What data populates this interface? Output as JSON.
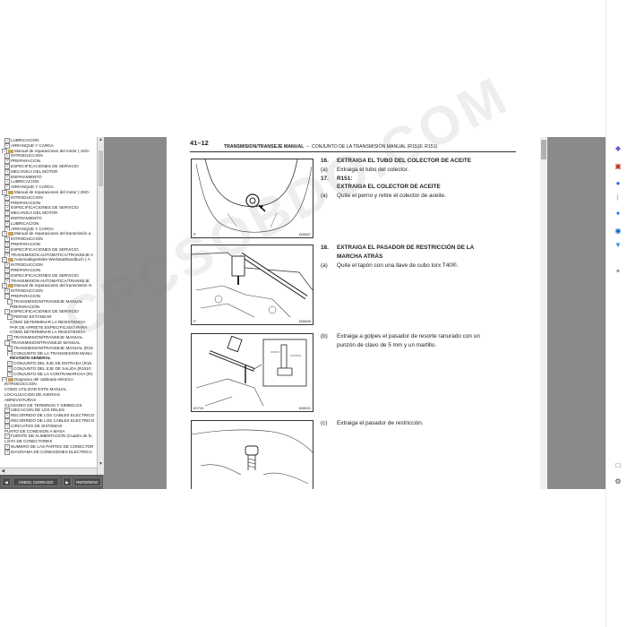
{
  "tree": {
    "items": [
      {
        "t": "LUBRICACION",
        "lvl": 1,
        "icon": "plus"
      },
      {
        "t": "ARRANQUE Y CARGA",
        "lvl": 1,
        "icon": "plus"
      },
      {
        "t": "Manual de reparaciones del motor ( 1KD-",
        "lvl": 0,
        "icon": "book"
      },
      {
        "t": "INTRODUCCION",
        "lvl": 1,
        "icon": "plus"
      },
      {
        "t": "PREPARACION",
        "lvl": 1,
        "icon": "plus"
      },
      {
        "t": "ESPECIFICACIONES DE SERVICIO",
        "lvl": 1,
        "icon": "plus"
      },
      {
        "t": "MECANICA DEL MOTOR",
        "lvl": 1,
        "icon": "plus"
      },
      {
        "t": "ENFRIAMIENTO",
        "lvl": 1,
        "icon": "plus"
      },
      {
        "t": "LUBRICACION",
        "lvl": 1,
        "icon": "plus"
      },
      {
        "t": "ARRANQUE Y CARGA",
        "lvl": 1,
        "icon": "plus"
      },
      {
        "t": "Manual de reparaciones del motor ( 2KD-",
        "lvl": 0,
        "icon": "book"
      },
      {
        "t": "INTRODUCCION",
        "lvl": 1,
        "icon": "plus"
      },
      {
        "t": "PREPARACION",
        "lvl": 1,
        "icon": "plus"
      },
      {
        "t": "ESPECIFICACIONES DE SERVICIO",
        "lvl": 1,
        "icon": "plus"
      },
      {
        "t": "MECANICA DEL MOTOR",
        "lvl": 1,
        "icon": "plus"
      },
      {
        "t": "ENFRIAMIENTO",
        "lvl": 1,
        "icon": "plus"
      },
      {
        "t": "LUBRICACION",
        "lvl": 1,
        "icon": "plus"
      },
      {
        "t": "ARRANQUE Y CARGA",
        "lvl": 1,
        "icon": "plus"
      },
      {
        "t": "Manual de reparaciones del transmisión a",
        "lvl": 0,
        "icon": "book"
      },
      {
        "t": "INTRODUCCION",
        "lvl": 1,
        "icon": "plus"
      },
      {
        "t": "PREPARACION",
        "lvl": 1,
        "icon": "plus"
      },
      {
        "t": "ESPECIFICACIONES DE SERVICIO",
        "lvl": 1,
        "icon": "plus"
      },
      {
        "t": "TRANSMISION AUTOMATICA/TRANSEJE A",
        "lvl": 1,
        "icon": "plus"
      },
      {
        "t": "Automatikgetriebe Werkstatthandbuch ( A",
        "lvl": 0,
        "icon": "book"
      },
      {
        "t": "INTRODUCCION",
        "lvl": 1,
        "icon": "plus"
      },
      {
        "t": "PREPARACION",
        "lvl": 1,
        "icon": "plus"
      },
      {
        "t": "ESPECIFICACIONES DE SERVICIO",
        "lvl": 1,
        "icon": "plus"
      },
      {
        "t": "TRANSMISION AUTOMATICA/TRANSEJE",
        "lvl": 1,
        "icon": "plus"
      },
      {
        "t": "Manual de reparaciones del transmisión m",
        "lvl": 0,
        "icon": "book"
      },
      {
        "t": "INTRODUCCION",
        "lvl": 1,
        "icon": "plus"
      },
      {
        "t": "PREPARACION",
        "lvl": 1,
        "icon": "minus"
      },
      {
        "t": "TRANSMISION/TRANSEJE MANUAL",
        "lvl": 2,
        "icon": "minus"
      },
      {
        "t": "PREPARACIÓN",
        "lvl": 3,
        "icon": "none"
      },
      {
        "t": "ESPECIFICACIONES DE SERVICIO",
        "lvl": 1,
        "icon": "minus"
      },
      {
        "t": "PERNO ESTÁNDAR",
        "lvl": 2,
        "icon": "minus"
      },
      {
        "t": "CÓMO DETERMINAR LA RESISTENCIA",
        "lvl": 3,
        "icon": "none"
      },
      {
        "t": "PAR DE APRIETE ESPECIFICADO PARA",
        "lvl": 3,
        "icon": "none"
      },
      {
        "t": "CÓMO DETERMINAR LA RESISTENCIA",
        "lvl": 3,
        "icon": "none"
      },
      {
        "t": "TRANSMISION/TRANSEJE MANUAL",
        "lvl": 2,
        "icon": "plus"
      },
      {
        "t": "TRANSMISION/TRANSEJE MANUAL",
        "lvl": 1,
        "icon": "minus"
      },
      {
        "t": "TRANSMISION/TRANSEJE MANUAL (R15",
        "lvl": 2,
        "icon": "plus"
      },
      {
        "t": "CONJUNTO DE LA TRANSMISIÓN MANU",
        "lvl": 2,
        "icon": "minus"
      },
      {
        "t": "REVISIÓN GENERAL",
        "lvl": 3,
        "icon": "none",
        "bold": true
      },
      {
        "t": "CONJUNTO DEL EJE DE ENTRADA (R15",
        "lvl": 2,
        "icon": "plus"
      },
      {
        "t": "CONJUNTO DEL EJE DE SALIDA (R151F,",
        "lvl": 2,
        "icon": "plus"
      },
      {
        "t": "CONJUNTO DE LA CONTRAMARCHA (R1",
        "lvl": 2,
        "icon": "plus"
      },
      {
        "t": "Diagrama del cableado eléctrico",
        "lvl": 0,
        "icon": "book"
      },
      {
        "t": "INTRODUCCION",
        "lvl": 1,
        "icon": "none"
      },
      {
        "t": "CÓMO UTILIZAR ESTE MANUAL",
        "lvl": 1,
        "icon": "none"
      },
      {
        "t": "LOCALIZACION DE AVERIAS",
        "lvl": 1,
        "icon": "none"
      },
      {
        "t": "ABREVIATURAS",
        "lvl": 1,
        "icon": "none"
      },
      {
        "t": "GLOSARIO DE TERMINOS Y SIMBOLOS",
        "lvl": 1,
        "icon": "none"
      },
      {
        "t": "UBICACION DE LOS RELES",
        "lvl": 1,
        "icon": "plus"
      },
      {
        "t": "RECORRIDO DE LOS CABLES ELECTRICO",
        "lvl": 1,
        "icon": "plus"
      },
      {
        "t": "RECORRIDO DE LOS CABLES ELECTRICO",
        "lvl": 1,
        "icon": "plus"
      },
      {
        "t": "CIRCUITOS DE SISTEMAS",
        "lvl": 1,
        "icon": "plus"
      },
      {
        "t": "PUNTO DE CONEXION A MASA",
        "lvl": 1,
        "icon": "none"
      },
      {
        "t": "FUENTE DE ALIMENTACION (Cuadro de fu",
        "lvl": 1,
        "icon": "plus"
      },
      {
        "t": "LISTA DE CONECTORES",
        "lvl": 1,
        "icon": "none"
      },
      {
        "t": "NUMERO DE LAS PARTES DE CONECTOR",
        "lvl": 1,
        "icon": "plus"
      },
      {
        "t": "DIAGRAMA DE CONEXIONES ELECTRICA",
        "lvl": 1,
        "icon": "plus"
      }
    ]
  },
  "toolbar": {
    "tree_label": "ÁRBOL CERRADO",
    "ref_label": "REFERENC"
  },
  "document": {
    "page_number": "41–12",
    "header_section": "TRANSMISION/TRANSEJE MANUAL",
    "header_dash": "–",
    "header_sub": "CONJUNTO DE LA TRANSMISIÓN MANUAL (R151F, R151)",
    "figures": [
      {
        "id": "D08637",
        "p": "P"
      },
      {
        "id": "D08646",
        "p": "P"
      },
      {
        "id": "D08021",
        "p": "",
        "extra": "K0715"
      },
      {
        "id": "",
        "p": ""
      }
    ],
    "steps": [
      {
        "n": "16.",
        "text": "EXTRAIGA EL TUBO DEL COLECTOR DE ACEITE",
        "bold": true
      },
      {
        "n": "(a)",
        "text": "Extraiga el tubo del colector.",
        "bold": false
      },
      {
        "n": "17.",
        "text": "R151:",
        "bold": true
      },
      {
        "n": "",
        "text": "EXTRAIGA EL COLECTOR DE ACEITE",
        "bold": true
      },
      {
        "n": "(a)",
        "text": "Quite el perno y retire el colector de aceite.",
        "bold": false
      },
      {
        "n": "18.",
        "text": "EXTRAIGA EL PASADOR DE RESTRICCIÓN DE LA",
        "bold": true
      },
      {
        "n": "",
        "text": "MARCHA ATRÁS",
        "bold": true
      },
      {
        "n": "(a)",
        "text": "Quite el tapón con una llave de cubo torx T40®.",
        "bold": false
      },
      {
        "n": "(b)",
        "text": "Extraiga a golpes el pasador de resorte ranurado con un",
        "bold": false
      },
      {
        "n": "",
        "text": "punzón de clavo de 5 mm y un martillo.",
        "bold": false
      },
      {
        "n": "(c)",
        "text": "Extraiga el pasador de restricción.",
        "bold": false
      }
    ]
  },
  "watermark": "CPCSOBDO.COM",
  "sidebar_icons": [
    "tag-icon",
    "briefcase-icon",
    "person-icon",
    "outlook-icon",
    "copilot-icon",
    "shop-icon",
    "add-icon",
    "window-icon",
    "settings-icon"
  ]
}
